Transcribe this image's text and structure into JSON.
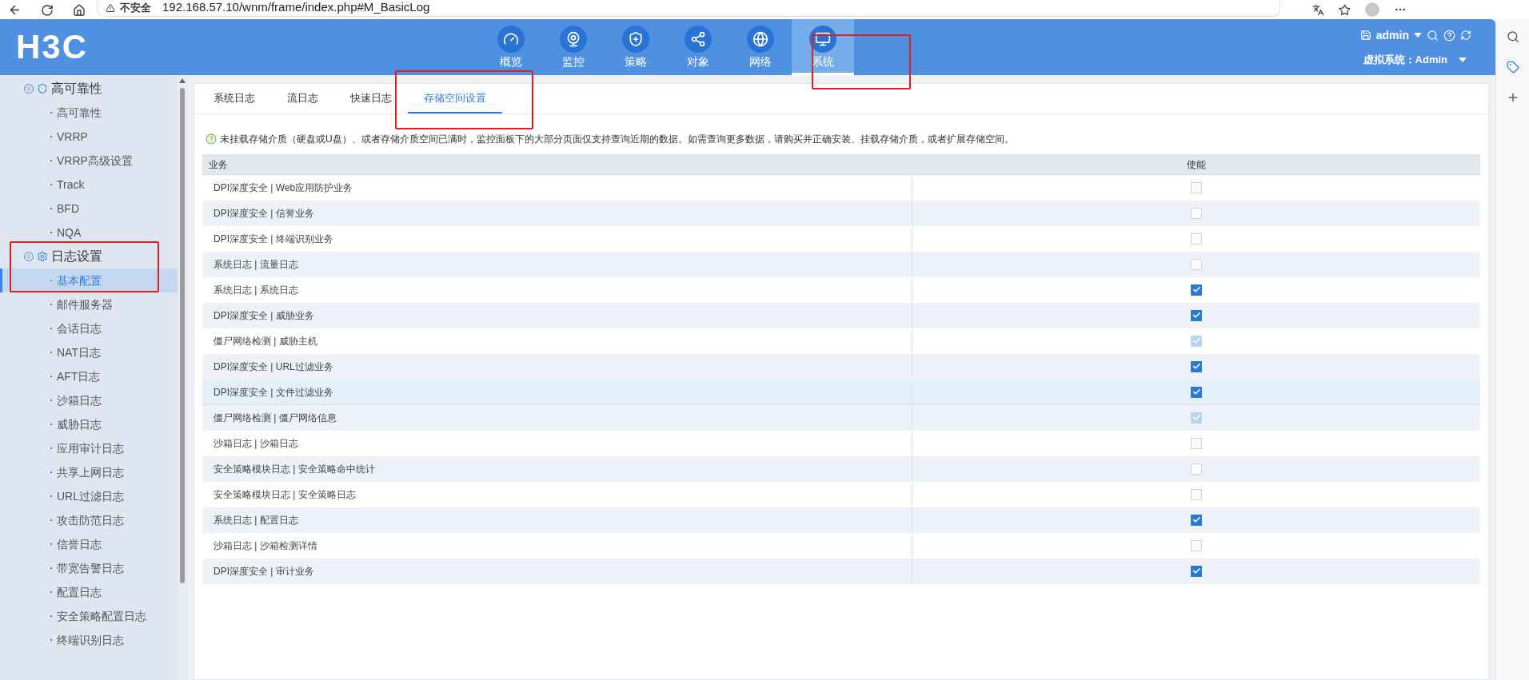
{
  "browser": {
    "security_label": "不安全",
    "url": "192.168.57.10/wnm/frame/index.php#M_BasicLog"
  },
  "header": {
    "logo": "H3C",
    "nav": [
      {
        "label": "概览",
        "selected": false
      },
      {
        "label": "监控",
        "selected": false
      },
      {
        "label": "策略",
        "selected": false
      },
      {
        "label": "对象",
        "selected": false
      },
      {
        "label": "网络",
        "selected": false
      },
      {
        "label": "系统",
        "selected": true
      }
    ],
    "user": "admin",
    "virtual_system": "虚拟系统：Admin"
  },
  "sidebar": {
    "groups": [
      {
        "label": "高可靠性",
        "expanded": true,
        "children": [
          {
            "label": "高可靠性",
            "selected": false
          },
          {
            "label": "VRRP",
            "selected": false
          },
          {
            "label": "VRRP高级设置",
            "selected": false
          },
          {
            "label": "Track",
            "selected": false
          },
          {
            "label": "BFD",
            "selected": false
          },
          {
            "label": "NQA",
            "selected": false
          }
        ]
      },
      {
        "label": "日志设置",
        "expanded": true,
        "children": [
          {
            "label": "基本配置",
            "selected": true
          },
          {
            "label": "邮件服务器",
            "selected": false
          },
          {
            "label": "会话日志",
            "selected": false
          },
          {
            "label": "NAT日志",
            "selected": false
          },
          {
            "label": "AFT日志",
            "selected": false
          },
          {
            "label": "沙箱日志",
            "selected": false
          },
          {
            "label": "威胁日志",
            "selected": false
          },
          {
            "label": "应用审计日志",
            "selected": false
          },
          {
            "label": "共享上网日志",
            "selected": false
          },
          {
            "label": "URL过滤日志",
            "selected": false
          },
          {
            "label": "攻击防范日志",
            "selected": false
          },
          {
            "label": "信誉日志",
            "selected": false
          },
          {
            "label": "带宽告警日志",
            "selected": false
          },
          {
            "label": "配置日志",
            "selected": false
          },
          {
            "label": "安全策略配置日志",
            "selected": false
          },
          {
            "label": "终端识别日志",
            "selected": false
          }
        ]
      }
    ]
  },
  "tabs": [
    {
      "label": "系统日志",
      "selected": false
    },
    {
      "label": "流日志",
      "selected": false
    },
    {
      "label": "快速日志",
      "selected": false
    },
    {
      "label": "存储空间设置",
      "selected": true
    }
  ],
  "notice": "未挂载存储介质（硬盘或U盘）、或者存储介质空间已满时，监控面板下的大部分页面仅支持查询近期的数据。如需查询更多数据，请购买并正确安装、挂载存储介质，或者扩展存储空间。",
  "table": {
    "columns": [
      "业务",
      "使能"
    ],
    "rows": [
      {
        "service": "DPI深度安全 | Web应用防护业务",
        "checked": false,
        "disabled": false,
        "hovered": false
      },
      {
        "service": "DPI深度安全 | 信誉业务",
        "checked": false,
        "disabled": false,
        "hovered": false
      },
      {
        "service": "DPI深度安全 | 终端识别业务",
        "checked": false,
        "disabled": false,
        "hovered": false
      },
      {
        "service": "系统日志 | 流量日志",
        "checked": false,
        "disabled": false,
        "hovered": false
      },
      {
        "service": "系统日志 | 系统日志",
        "checked": true,
        "disabled": false,
        "hovered": false
      },
      {
        "service": "DPI深度安全 | 威胁业务",
        "checked": true,
        "disabled": false,
        "hovered": false
      },
      {
        "service": "僵尸网络检测 | 威胁主机",
        "checked": true,
        "disabled": true,
        "hovered": false
      },
      {
        "service": "DPI深度安全 | URL过滤业务",
        "checked": true,
        "disabled": false,
        "hovered": false
      },
      {
        "service": "DPI深度安全 | 文件过滤业务",
        "checked": true,
        "disabled": false,
        "hovered": true
      },
      {
        "service": "僵尸网络检测 | 僵尸网络信息",
        "checked": true,
        "disabled": true,
        "hovered": false
      },
      {
        "service": "沙箱日志 | 沙箱日志",
        "checked": false,
        "disabled": false,
        "hovered": false
      },
      {
        "service": "安全策略模块日志 | 安全策略命中统计",
        "checked": false,
        "disabled": false,
        "hovered": false
      },
      {
        "service": "安全策略模块日志 | 安全策略日志",
        "checked": false,
        "disabled": false,
        "hovered": false
      },
      {
        "service": "系统日志 | 配置日志",
        "checked": true,
        "disabled": false,
        "hovered": false
      },
      {
        "service": "沙箱日志 | 沙箱检测详情",
        "checked": false,
        "disabled": false,
        "hovered": false
      },
      {
        "service": "DPI深度安全 | 审计业务",
        "checked": true,
        "disabled": false,
        "hovered": false
      }
    ]
  }
}
